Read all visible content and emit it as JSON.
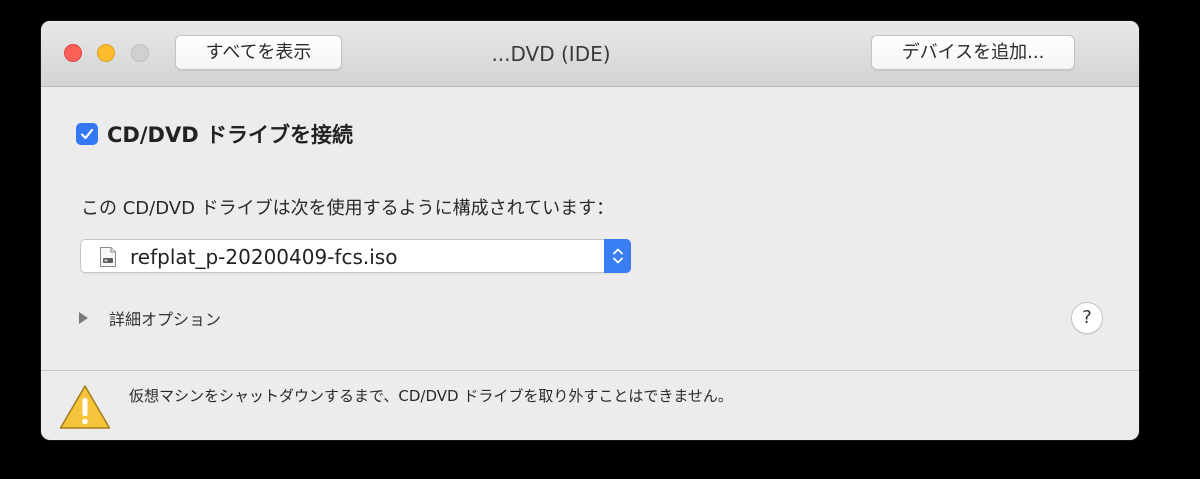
{
  "window": {
    "title": "...DVD (IDE)",
    "show_all_label": "すべてを表示",
    "add_device_label": "デバイスを追加..."
  },
  "connect": {
    "checked": true,
    "label": "CD/DVD ドライブを接続"
  },
  "config": {
    "description": "この CD/DVD ドライブは次を使用するように構成されています：",
    "selected_file": "refplat_p-20200409-fcs.iso",
    "file_icon": "disk-image-file-icon"
  },
  "advanced": {
    "label": "詳細オプション",
    "expanded": false
  },
  "help": {
    "label": "?"
  },
  "warning": {
    "icon": "warning-triangle-icon",
    "text": "仮想マシンをシャットダウンするまで、CD/DVD ドライブを取り外すことはできません。"
  },
  "colors": {
    "accent": "#3478f6",
    "close": "#fc5f57",
    "minimize": "#fdbc2e",
    "zoom_disabled": "#d0d0d0",
    "warning": "#f6c43a"
  }
}
